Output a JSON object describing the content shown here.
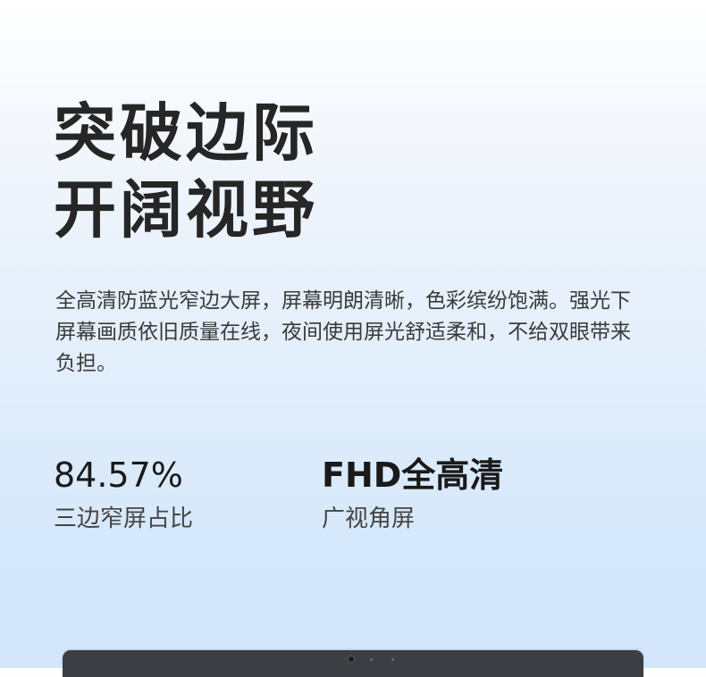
{
  "headline": {
    "line1": "突破边际",
    "line2": "开阔视野"
  },
  "description": "全高清防蓝光窄边大屏，屏幕明朗清晰，色彩缤纷饱满。强光下屏幕画质依旧质量在线，夜间使用屏光舒适柔和，不给双眼带来负担。",
  "stats": [
    {
      "value": "84.57%",
      "label": "三边窄屏占比"
    },
    {
      "value": "FHD全高清",
      "label": "广视角屏"
    }
  ],
  "colors": {
    "headline": "#262626",
    "body_text": "#3a3a3a",
    "laptop_bezel": "#3c3f43",
    "background_top": "#ffffff",
    "background_bottom": "#d3e6fb"
  }
}
